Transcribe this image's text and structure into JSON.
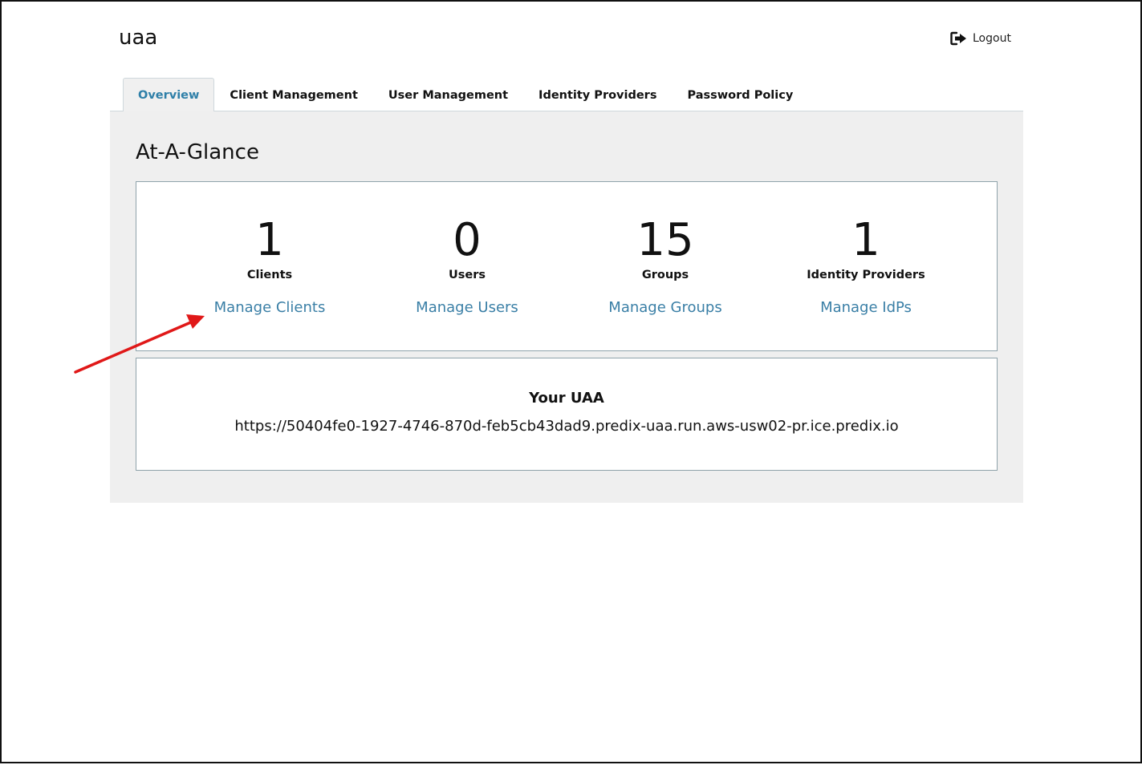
{
  "header": {
    "app_title": "uaa",
    "logout_label": "Logout",
    "logout_icon": "sign-out-icon"
  },
  "tabs": [
    {
      "label": "Overview",
      "active": true
    },
    {
      "label": "Client Management",
      "active": false
    },
    {
      "label": "User Management",
      "active": false
    },
    {
      "label": "Identity Providers",
      "active": false
    },
    {
      "label": "Password Policy",
      "active": false
    }
  ],
  "overview": {
    "heading": "At-A-Glance",
    "stats": [
      {
        "count": "1",
        "label": "Clients",
        "link": "Manage Clients"
      },
      {
        "count": "0",
        "label": "Users",
        "link": "Manage Users"
      },
      {
        "count": "15",
        "label": "Groups",
        "link": "Manage Groups"
      },
      {
        "count": "1",
        "label": "Identity Providers",
        "link": "Manage IdPs"
      }
    ]
  },
  "your_uaa": {
    "title": "Your UAA",
    "url": "https://50404fe0-1927-4746-870d-feb5cb43dad9.predix-uaa.run.aws-usw02-pr.ice.predix.io"
  },
  "colors": {
    "accent": "#2e7fa8",
    "link": "#3a7fa6",
    "panel_bg": "#efefef",
    "annotation_arrow": "#e01818"
  }
}
